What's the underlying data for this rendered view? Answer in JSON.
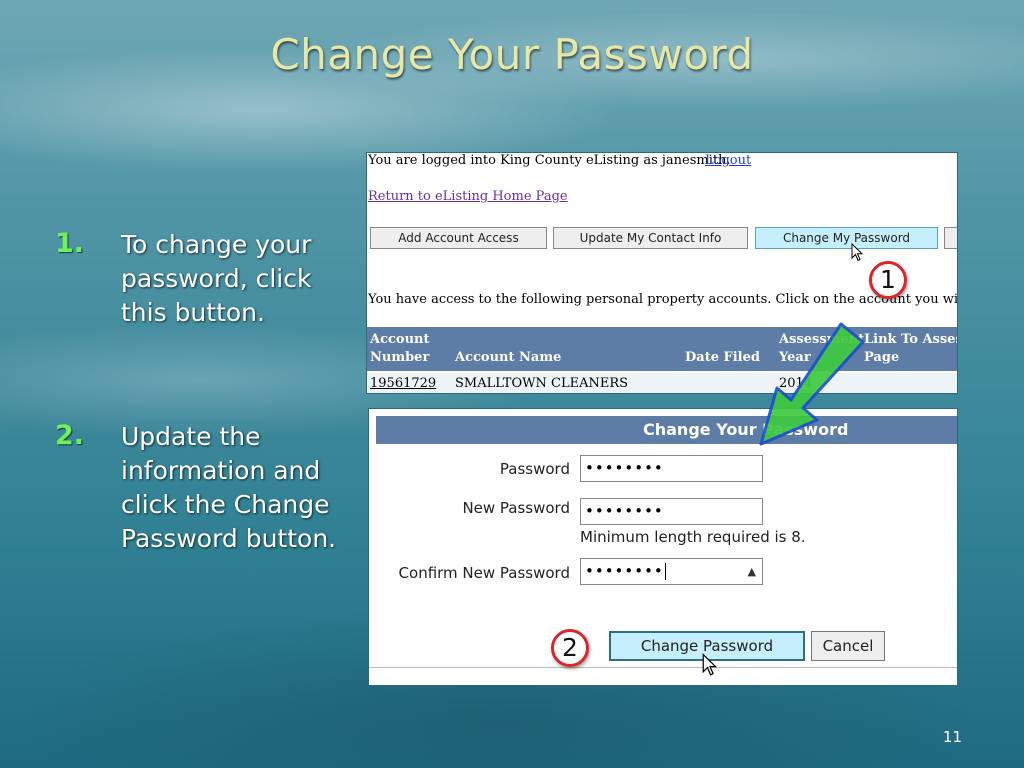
{
  "slide": {
    "title": "Change Your Password",
    "page_number": "11"
  },
  "steps": [
    {
      "number": "1.",
      "text": "To change your password, click this button."
    },
    {
      "number": "2.",
      "text": "Update the information and click the Change Password button."
    }
  ],
  "screenshot1": {
    "login_text": "You are logged into King County eListing as janesmith.",
    "logout_link": "Logout",
    "return_link": "Return to eListing Home Page",
    "buttons": [
      "Add Account Access",
      "Update My Contact Info",
      "Change My Password"
    ],
    "access_text": "You have access to the following personal property accounts. Click on the account you wish to view.",
    "table_headers": {
      "account_number_1": "Account",
      "account_number_2": "Number",
      "account_name": "Account Name",
      "date_filed": "Date Filed",
      "assessment_year_1": "Assessment",
      "assessment_year_2": "Year",
      "link_1": "Link To Asses",
      "link_2": "Page"
    },
    "row": {
      "account_number": "19561729",
      "account_name": "SMALLTOWN CLEANERS",
      "date_filed": "",
      "assessment_year": "2014"
    }
  },
  "screenshot2": {
    "header": "Change Your Password",
    "password_label": "Password",
    "password_value": "••••••••",
    "new_password_label": "New Password",
    "new_password_value": "••••••••",
    "hint": "Minimum length required is 8.",
    "confirm_label": "Confirm New Password",
    "confirm_value": "••••••••",
    "change_button": "Change Password",
    "cancel_button": "Cancel"
  },
  "callouts": {
    "one": "1",
    "two": "2"
  },
  "colors": {
    "title": "#e7e7a6",
    "step_number": "#6df05a",
    "table_header": "#5d7da6",
    "active_button": "#c5f0fb",
    "callout_border": "#d8262a",
    "arrow": "#3ec93e"
  }
}
